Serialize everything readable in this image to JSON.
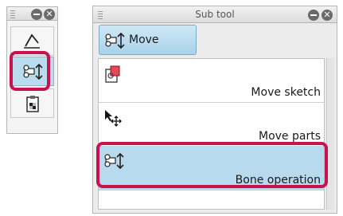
{
  "colors": {
    "highlight": "#c8124f",
    "selected": "#b8daee",
    "titlebar": "#dcdcdc"
  },
  "tool_palette": {
    "icons": [
      "compass-ruler-icon",
      "bone-operation-move-icon",
      "clipboard-checker-icon"
    ],
    "window_buttons": {
      "minimize_icon": "minimize-icon",
      "close": "✕"
    }
  },
  "subtool_panel": {
    "title": "Sub tool",
    "group": {
      "label": "Move",
      "icon": "move-group-icon"
    },
    "items": [
      {
        "label": "Move sketch",
        "icon": "move-sketch-icon"
      },
      {
        "label": "Move parts",
        "icon": "move-parts-icon"
      },
      {
        "label": "Bone operation",
        "icon": "bone-operation-icon",
        "selected": true
      }
    ],
    "window_buttons": {
      "minimize_icon": "minimize-icon",
      "close": "✕"
    }
  }
}
